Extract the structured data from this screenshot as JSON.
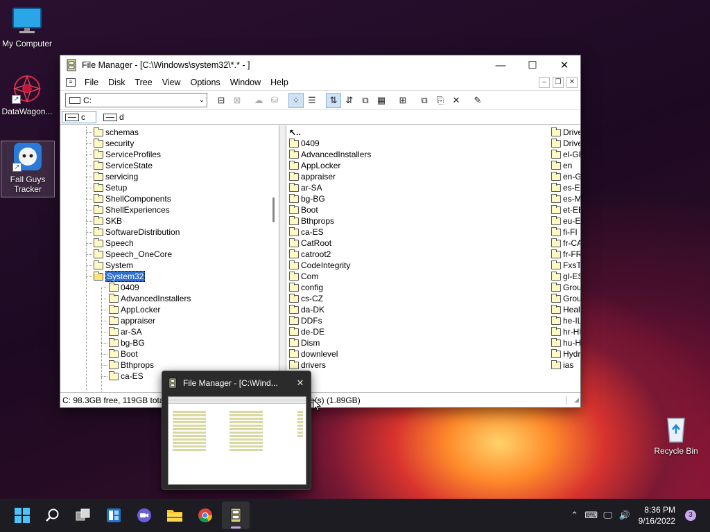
{
  "desktop": {
    "icons": [
      {
        "label": "My Computer"
      },
      {
        "label": "DataWagon..."
      },
      {
        "label": "Fall Guys Tracker"
      },
      {
        "label": "Recycle Bin"
      }
    ]
  },
  "window": {
    "title": "File Manager - [C:\\Windows\\system32\\*.* - ]",
    "menu": [
      "File",
      "Disk",
      "Tree",
      "View",
      "Options",
      "Window",
      "Help"
    ],
    "drive_combo": "C:",
    "drives": [
      {
        "label": "c"
      },
      {
        "label": "d"
      }
    ],
    "tree": {
      "top": [
        "schemas",
        "security",
        "ServiceProfiles",
        "ServiceState",
        "servicing",
        "Setup",
        "ShellComponents",
        "ShellExperiences",
        "SKB",
        "SoftwareDistribution",
        "Speech",
        "Speech_OneCore",
        "System"
      ],
      "selected": "System32",
      "children": [
        "0409",
        "AdvancedInstallers",
        "AppLocker",
        "appraiser",
        "ar-SA",
        "bg-BG",
        "Boot",
        "Bthprops",
        "ca-ES"
      ]
    },
    "dir_col1": [
      "0409",
      "AdvancedInstallers",
      "AppLocker",
      "appraiser",
      "ar-SA",
      "bg-BG",
      "Boot",
      "Bthprops",
      "ca-ES",
      "CatRoot",
      "catroot2",
      "CodeIntegrity",
      "Com",
      "config",
      "cs-CZ",
      "da-DK",
      "DDFs",
      "de-DE",
      "Dism",
      "downlevel",
      "drivers"
    ],
    "dir_col2": [
      "Driver",
      "Driver",
      "el-GR",
      "en",
      "en-GB",
      "es-ES",
      "es-MX",
      "et-EE",
      "eu-ES",
      "fi-FI",
      "fr-CA",
      "fr-FR",
      "FxsTr",
      "gl-ES",
      "Group",
      "Group",
      "Health",
      "he-IL",
      "hr-HR",
      "hu-HU",
      "Hydro",
      "ias"
    ],
    "status_left": "C: 98.3GB free,  119GB total",
    "status_right": "e(s) (1.89GB)"
  },
  "thumbnail": {
    "title": "File Manager - [C:\\Wind..."
  },
  "taskbar": {
    "time": "8:36 PM",
    "date": "9/16/2022",
    "notification_count": "3"
  }
}
